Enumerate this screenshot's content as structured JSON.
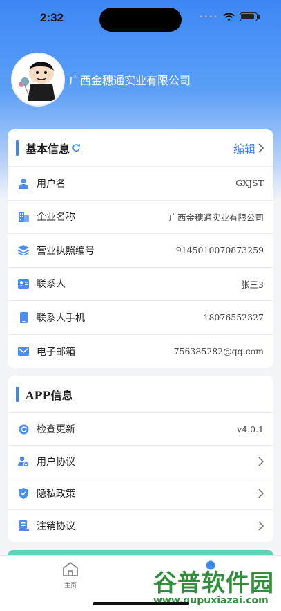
{
  "status_bar": {
    "time": "2:32"
  },
  "profile": {
    "company_name": "广西金穗通实业有限公司"
  },
  "basic_info": {
    "title": "基本信息",
    "edit_label": "编辑",
    "rows": [
      {
        "label": "用户名",
        "value": "GXJST",
        "icon": "user-icon"
      },
      {
        "label": "企业名称",
        "value": "广西金穗通实业有限公司",
        "icon": "building-icon"
      },
      {
        "label": "营业执照编号",
        "value": "9145010070873259",
        "icon": "layers-icon"
      },
      {
        "label": "联系人",
        "value": "张三3",
        "icon": "contact-card-icon"
      },
      {
        "label": "联系人手机",
        "value": "18076552327",
        "icon": "phone-icon"
      },
      {
        "label": "电子邮箱",
        "value": "756385282@qq.com",
        "icon": "mail-icon"
      }
    ]
  },
  "app_info": {
    "title": "APP信息",
    "rows": [
      {
        "label": "检查更新",
        "value": "v4.0.1",
        "icon": "update-icon"
      },
      {
        "label": "用户协议",
        "icon": "user-agreement-icon"
      },
      {
        "label": "隐私政策",
        "icon": "shield-icon"
      },
      {
        "label": "注销协议",
        "icon": "cancel-account-icon"
      }
    ]
  },
  "tabbar": {
    "home_label": "主页"
  },
  "watermark": {
    "main": "谷普软件园",
    "sub": "www.gupuxiazai.com"
  },
  "colors": {
    "accent": "#3d87f5",
    "teal": "#5fd1b6"
  }
}
